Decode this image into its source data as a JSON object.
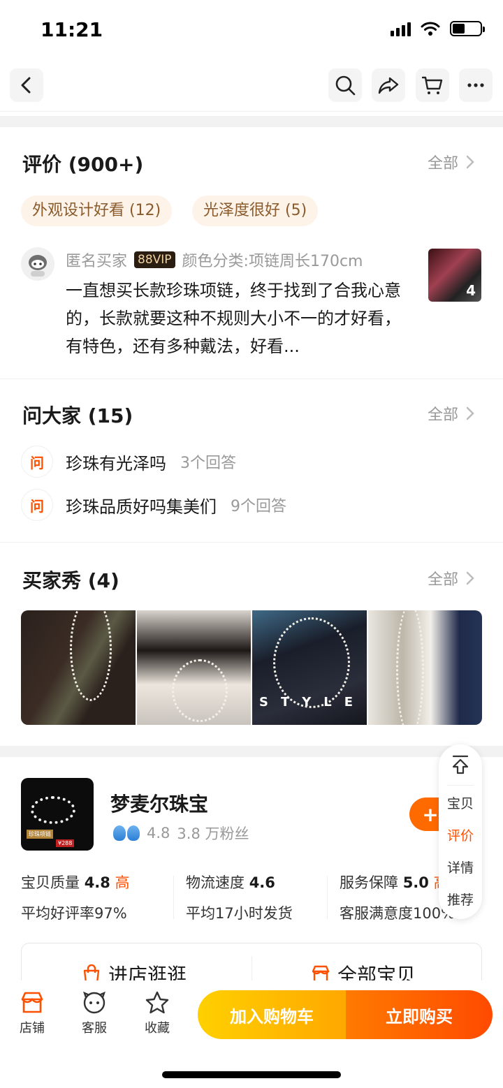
{
  "status_bar": {
    "time": "11:21"
  },
  "reviews": {
    "title": "评价 (900+)",
    "more": "全部",
    "tags": [
      "外观设计好看 (12)",
      "光泽度很好 (5)"
    ],
    "item": {
      "user": "匿名买家",
      "vip": "88VIP",
      "sku": "颜色分类:项链周长170cm",
      "text": "一直想买长款珍珠项链，终于找到了合我心意的，长款就要这种不规则大小不一的才好看，有特色，还有多种戴法，好看...",
      "image_count": "4"
    }
  },
  "qa": {
    "title": "问大家 (15)",
    "more": "全部",
    "icon_label": "问",
    "items": [
      {
        "question": "珍珠有光泽吗",
        "answers": "3个回答"
      },
      {
        "question": "珍珠品质好吗集美们",
        "answers": "9个回答"
      }
    ]
  },
  "buyer_show": {
    "title": "买家秀 (4)",
    "more": "全部",
    "overlay_text": "STYLE"
  },
  "shop": {
    "name": "梦麦尔珠宝",
    "rating": "4.8",
    "fans": "3.8 万粉丝",
    "follow_label": "+",
    "logo_badge": "珍珠项链",
    "logo_price": "¥288",
    "scores": [
      {
        "label": "宝贝质量",
        "value": "4.8",
        "level": "高",
        "detail": "平均好评率97%"
      },
      {
        "label": "物流速度",
        "value": "4.6",
        "level": "",
        "detail": "平均17小时发货"
      },
      {
        "label": "服务保障",
        "value": "5.0",
        "level": "高",
        "detail": "客服满意度100%"
      }
    ],
    "visit_label": "进店逛逛",
    "all_items_label": "全部宝贝"
  },
  "float_nav": {
    "items": [
      "宝贝",
      "评价",
      "详情",
      "推荐"
    ],
    "active": "评价"
  },
  "bottom_bar": {
    "tabs": [
      "店铺",
      "客服",
      "收藏"
    ],
    "add_to_cart": "加入购物车",
    "buy_now": "立即购买"
  },
  "colors": {
    "accent": "#ff5000",
    "tag_bg": "#fdf3e8",
    "tag_text": "#8a5a2b"
  }
}
